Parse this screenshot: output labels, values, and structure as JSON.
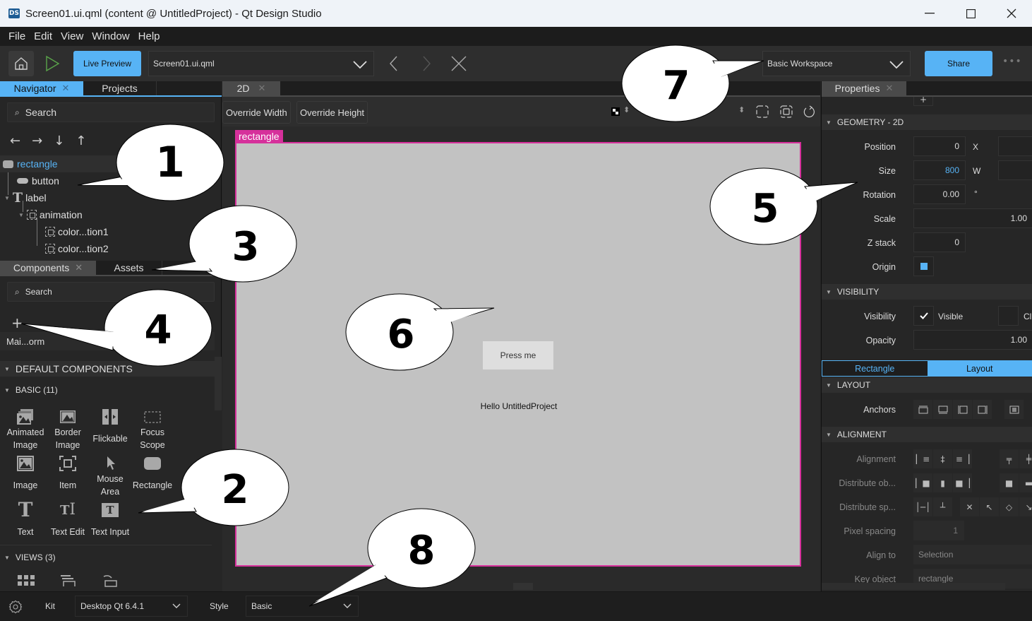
{
  "window": {
    "app_icon": "DS",
    "title": "Screen01.ui.qml (content @ UntitledProject) - Qt Design Studio",
    "controls": [
      "minimize",
      "maximize",
      "close"
    ]
  },
  "menubar": {
    "items": [
      "File",
      "Edit",
      "View",
      "Window",
      "Help"
    ]
  },
  "toolbar": {
    "live_preview_label": "Live Preview",
    "current_file": "Screen01.ui.qml",
    "workspace": "Basic  Workspace",
    "share_label": "Share",
    "more": "•••",
    "accent_color": "#57b3f5"
  },
  "navigator": {
    "tabs": [
      {
        "label": "Navigator",
        "close": "✕"
      },
      {
        "label": "Projects"
      }
    ],
    "search_placeholder": "Search",
    "arrows": [
      "←",
      "→",
      "↓",
      "↑"
    ],
    "tree": [
      {
        "label": "rectangle",
        "icon": "rectangle-icon",
        "selected": true
      },
      {
        "label": "button",
        "icon": "button-icon"
      },
      {
        "label": "label",
        "icon": "text-icon"
      },
      {
        "label": "animation",
        "icon": "item-icon"
      },
      {
        "label": "color...tion1",
        "icon": "item-icon"
      },
      {
        "label": "color...tion2",
        "icon": "item-icon"
      }
    ]
  },
  "components": {
    "tabs": [
      {
        "label": "Components",
        "close": "✕"
      },
      {
        "label": "Assets"
      }
    ],
    "search_placeholder": "Search",
    "add_label": "+",
    "module_label": "Mai...orm",
    "default_header": "DEFAULT COMPONENTS",
    "basic_header": "BASIC (11)",
    "basic_items": [
      [
        "Animated",
        "Image"
      ],
      [
        "Border",
        "Image"
      ],
      [
        "Flickable"
      ],
      [
        "Focus",
        "Scope"
      ],
      [
        "Image"
      ],
      [
        "Item"
      ],
      [
        "Mouse",
        "Area"
      ],
      [
        "Rectangle"
      ],
      [
        "Text"
      ],
      [
        "Text Edit"
      ],
      [
        "Text Input"
      ]
    ],
    "views_header": "VIEWS (3)"
  },
  "editor": {
    "tab_label": "2D",
    "tab_close": "✕",
    "override_width": "Override Width",
    "override_height": "Override Height",
    "selection_label": "rectangle",
    "selection_color": "#d6309b",
    "canvas_color": "#c2c2c2",
    "button_text": "Press me",
    "label_text": "Hello UntitledProject"
  },
  "properties": {
    "tab_label": "Properties",
    "tab_close": "✕",
    "add_label": "+",
    "geometry_header": "GEOMETRY - 2D",
    "position": {
      "label": "Position",
      "x": "0",
      "axis": "X"
    },
    "size": {
      "label": "Size",
      "w": "800",
      "axis": "W"
    },
    "rotation": {
      "label": "Rotation",
      "value": "0.00",
      "unit": "°"
    },
    "scale": {
      "label": "Scale",
      "value": "1.00"
    },
    "z_stack": {
      "label": "Z stack",
      "value": "0"
    },
    "origin": {
      "label": "Origin"
    },
    "visibility_header": "VISIBILITY",
    "visibility": {
      "label": "Visibility",
      "checkbox_label": "Visible",
      "checked": true,
      "clip_label": "Cli"
    },
    "opacity": {
      "label": "Opacity",
      "value": "1.00"
    },
    "segments": [
      "Rectangle",
      "Layout"
    ],
    "layout_header": "LAYOUT",
    "anchors_label": "Anchors",
    "alignment_header": "ALIGNMENT",
    "alignment_label": "Alignment",
    "distribute_objects_label": "Distribute ob...",
    "distribute_spacing_label": "Distribute sp...",
    "pixel_spacing": {
      "label": "Pixel spacing",
      "value": "1"
    },
    "align_to": {
      "label": "Align to",
      "value": "Selection"
    },
    "key_object": {
      "label": "Key object",
      "value": "rectangle"
    }
  },
  "statusbar": {
    "kit_label": "Kit",
    "kit_value": "Desktop Qt 6.4.1",
    "style_label": "Style",
    "style_value": "Basic"
  },
  "callouts": [
    "1",
    "2",
    "3",
    "4",
    "5",
    "6",
    "7",
    "8"
  ]
}
